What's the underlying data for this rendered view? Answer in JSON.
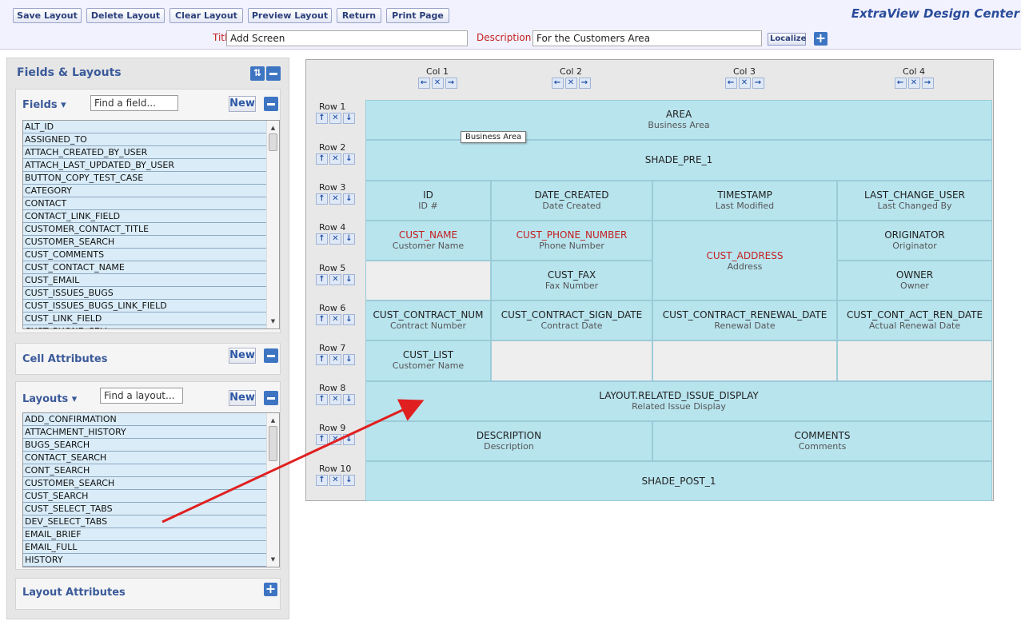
{
  "toolbar": {
    "buttons": [
      "Save Layout",
      "Delete Layout",
      "Clear Layout",
      "Preview Layout",
      "Return",
      "Print Page"
    ],
    "brand": "ExtraView Design Center"
  },
  "header_form": {
    "title_label": "Title",
    "title_value": "Add Screen",
    "description_label": "Description",
    "description_value": "For the Customers Area",
    "localize_label": "Localize"
  },
  "left_panel": {
    "title": "Fields & Layouts",
    "fields": {
      "label": "Fields ▾",
      "find_value": "Find a field...",
      "new_label": "New",
      "items": [
        "ALT_ID",
        "ASSIGNED_TO",
        "ATTACH_CREATED_BY_USER",
        "ATTACH_LAST_UPDATED_BY_USER",
        "BUTTON_COPY_TEST_CASE",
        "CATEGORY",
        "CONTACT",
        "CONTACT_LINK_FIELD",
        "CUSTOMER_CONTACT_TITLE",
        "CUSTOMER_SEARCH",
        "CUST_COMMENTS",
        "CUST_CONTACT_NAME",
        "CUST_EMAIL",
        "CUST_ISSUES_BUGS",
        "CUST_ISSUES_BUGS_LINK_FIELD",
        "CUST_LINK_FIELD",
        "CUST_PHONE_CELL"
      ]
    },
    "cell_attributes": {
      "title": "Cell Attributes",
      "new_label": "New"
    },
    "layouts": {
      "label": "Layouts ▾",
      "find_value": "Find a layout...",
      "new_label": "New",
      "items": [
        "ADD_CONFIRMATION",
        "ATTACHMENT_HISTORY",
        "BUGS_SEARCH",
        "CONTACT_SEARCH",
        "CONT_SEARCH",
        "CUSTOMER_SEARCH",
        "CUST_SEARCH",
        "CUST_SELECT_TABS",
        "DEV_SELECT_TABS",
        "EMAIL_BRIEF",
        "EMAIL_FULL",
        "HISTORY"
      ]
    },
    "layout_attributes": {
      "title": "Layout Attributes"
    }
  },
  "grid": {
    "columns": [
      "Col 1",
      "Col 2",
      "Col 3",
      "Col 4"
    ],
    "rows": [
      "Row 1",
      "Row 2",
      "Row 3",
      "Row 4",
      "Row 5",
      "Row 6",
      "Row 7",
      "Row 8",
      "Row 9",
      "Row 10"
    ],
    "cells": {
      "area": {
        "name": "AREA",
        "desc": "Business Area"
      },
      "shade_pre": {
        "name": "SHADE_PRE_1"
      },
      "id": {
        "name": "ID",
        "desc": "ID #"
      },
      "date_created": {
        "name": "DATE_CREATED",
        "desc": "Date Created"
      },
      "timestamp": {
        "name": "TIMESTAMP",
        "desc": "Last Modified"
      },
      "last_change_user": {
        "name": "LAST_CHANGE_USER",
        "desc": "Last Changed By"
      },
      "cust_name": {
        "name": "CUST_NAME",
        "desc": "Customer Name"
      },
      "cust_phone": {
        "name": "CUST_PHONE_NUMBER",
        "desc": "Phone Number"
      },
      "cust_address": {
        "name": "CUST_ADDRESS",
        "desc": "Address"
      },
      "originator": {
        "name": "ORIGINATOR",
        "desc": "Originator"
      },
      "cust_fax": {
        "name": "CUST_FAX",
        "desc": "Fax Number"
      },
      "owner": {
        "name": "OWNER",
        "desc": "Owner"
      },
      "contract_num": {
        "name": "CUST_CONTRACT_NUM",
        "desc": "Contract Number"
      },
      "contract_sign": {
        "name": "CUST_CONTRACT_SIGN_DATE",
        "desc": "Contract Date"
      },
      "contract_renewal": {
        "name": "CUST_CONTRACT_RENEWAL_DATE",
        "desc": "Renewal Date"
      },
      "cont_act_ren": {
        "name": "CUST_CONT_ACT_REN_DATE",
        "desc": "Actual Renewal Date"
      },
      "cust_list": {
        "name": "CUST_LIST",
        "desc": "Customer Name"
      },
      "related_issue": {
        "name": "LAYOUT.RELATED_ISSUE_DISPLAY",
        "desc": "Related Issue Display"
      },
      "description": {
        "name": "DESCRIPTION",
        "desc": "Description"
      },
      "comments": {
        "name": "COMMENTS",
        "desc": "Comments"
      },
      "shade_post": {
        "name": "SHADE_POST_1"
      }
    },
    "tooltip": "Business Area"
  },
  "colors": {
    "cell": "#b8e4ee",
    "required": "#c42020",
    "arrow": "#e02020",
    "accent": "#3e75c3"
  },
  "icons": [
    "left-arrow-icon",
    "right-arrow-icon",
    "up-arrow-icon",
    "down-arrow-icon",
    "delete-x-icon",
    "plus-icon",
    "minus-icon",
    "refresh-icon"
  ]
}
